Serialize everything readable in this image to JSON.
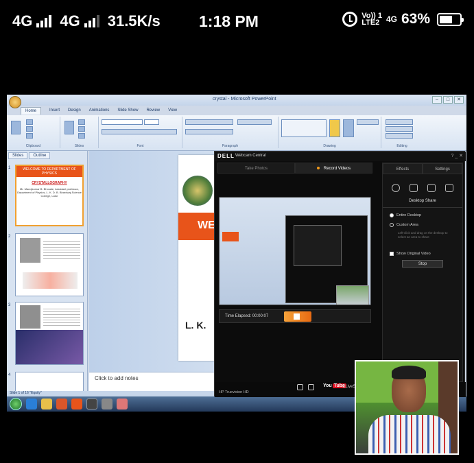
{
  "status_bar": {
    "network1": "4G",
    "network2": "4G",
    "speed": "31.5K/s",
    "time": "1:18 PM",
    "volte_top": "Vo)) 1",
    "volte_bottom": "LTE2",
    "network3": "4G",
    "battery": "63%",
    "battery_level": 0.63
  },
  "powerpoint": {
    "title": "crystal - Microsoft PowerPoint",
    "ribbon_tabs": [
      "Home",
      "Insert",
      "Design",
      "Animations",
      "Slide Show",
      "Review",
      "View"
    ],
    "ribbon_groups": [
      "Clipboard",
      "Slides",
      "Font",
      "Paragraph",
      "Drawing",
      "Editing"
    ],
    "pane_tabs": [
      "Slides",
      "Outline"
    ],
    "slide1": {
      "header": "WELCOME TO DEPARTMENT OF PHYSICS",
      "title": "CRYSTALLOGRAPHY",
      "body": "Mr. Manojkumar B. Bhosale, Assistant professor, Department of Physics, L. K. D. B. Bhardwaj Science College, Latur"
    },
    "slide_numbers": [
      "1",
      "2",
      "3",
      "4"
    ],
    "canvas_text": "WE",
    "canvas_lk": "L. K.",
    "notes_placeholder": "Click to add notes",
    "status_text": "Slide 1 of 16   \"Equity\""
  },
  "webcam_central": {
    "brand": "DELL",
    "app_title": "Webcam Central",
    "window_controls": "? _ ✕",
    "tabs": [
      "Take Photos",
      "Record Videos"
    ],
    "active_tab": "Record Videos",
    "time_elapsed": "Time Elapsed: 00:00:07",
    "right_tabs": [
      "Effects",
      "Settings"
    ],
    "section_title": "Desktop Share",
    "options": [
      "Entire Desktop",
      "Custom Area"
    ],
    "hint": "Left-click and drag on the desktop to select an area to share",
    "show_original": "Show Original Video",
    "stop": "Stop",
    "footer": "HP Truevision HD",
    "youtube": "You",
    "youtube_tube": "Tube",
    "clive": "CLiveShare"
  },
  "colors": {
    "office_orange": "#e8541a",
    "record_orange": "#f29a1c",
    "dell_bg": "#0c0c0c"
  }
}
